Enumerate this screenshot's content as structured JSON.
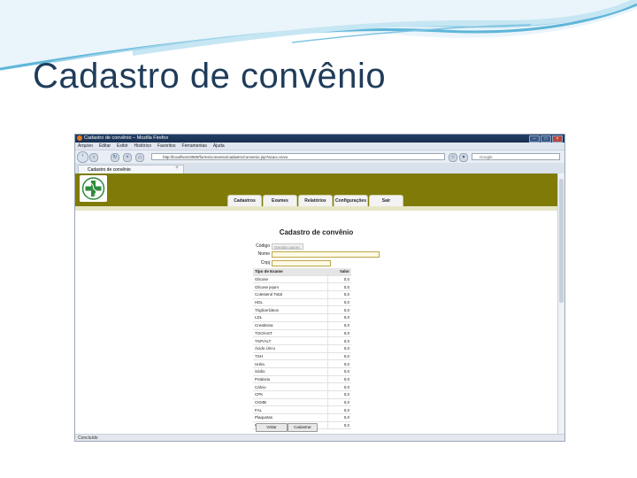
{
  "slide": {
    "title": "Cadastro de convênio"
  },
  "browser": {
    "window_title": "Cadastro de convênio – Mozilla Firefox",
    "menu": [
      "Arquivo",
      "Editar",
      "Exibir",
      "Histórico",
      "Favoritos",
      "Ferramentas",
      "Ajuda"
    ],
    "url": "http://localhost:8080/forms/convenio/cadastroConvenio.jsp?acao=novo",
    "search_placeholder": "Google",
    "tab_label": "Cadastro de convênio",
    "new_tab": "+",
    "status": "Concluído"
  },
  "app": {
    "nav_tabs": [
      "Cadastros",
      "Exames",
      "Relatórios",
      "Configurações",
      "Sair"
    ],
    "form_title": "Cadastro de convênio",
    "fields": {
      "codigo_label": "Código",
      "codigo_value": "Gerado autom.",
      "nome_label": "Nome",
      "nome_value": "",
      "cnpj_label": "Cnpj",
      "cnpj_value": ""
    },
    "table": {
      "headers": [
        "Tipo de Exame",
        "Valor"
      ],
      "rows": [
        [
          "Glicose",
          "0,0"
        ],
        [
          "Glicose jejum",
          "0,0"
        ],
        [
          "Colesterol Total",
          "0,0"
        ],
        [
          "HDL",
          "0,0"
        ],
        [
          "Triglicerídeos",
          "0,0"
        ],
        [
          "LDL",
          "0,0"
        ],
        [
          "Creatinina",
          "0,0"
        ],
        [
          "TGO/AST",
          "0,0"
        ],
        [
          "TGP/ALT",
          "0,0"
        ],
        [
          "Ácido Úrico",
          "0,0"
        ],
        [
          "TSH",
          "0,0"
        ],
        [
          "Uréia",
          "0,0"
        ],
        [
          "Sódio",
          "0,0"
        ],
        [
          "Potássio",
          "0,0"
        ],
        [
          "Cálcio",
          "0,0"
        ],
        [
          "CPK",
          "0,0"
        ],
        [
          "CKMB",
          "0,0"
        ],
        [
          "FAL",
          "0,0"
        ],
        [
          "Plaquetas",
          "0,0"
        ],
        [
          "Urina",
          "0,0"
        ]
      ]
    },
    "buttons": {
      "voltar": "Voltar",
      "cadastrar": "Cadastrar"
    }
  },
  "colors": {
    "banner": "#7f7b06",
    "title_text": "#1f3c5a",
    "input_bg": "#fffbe6"
  }
}
